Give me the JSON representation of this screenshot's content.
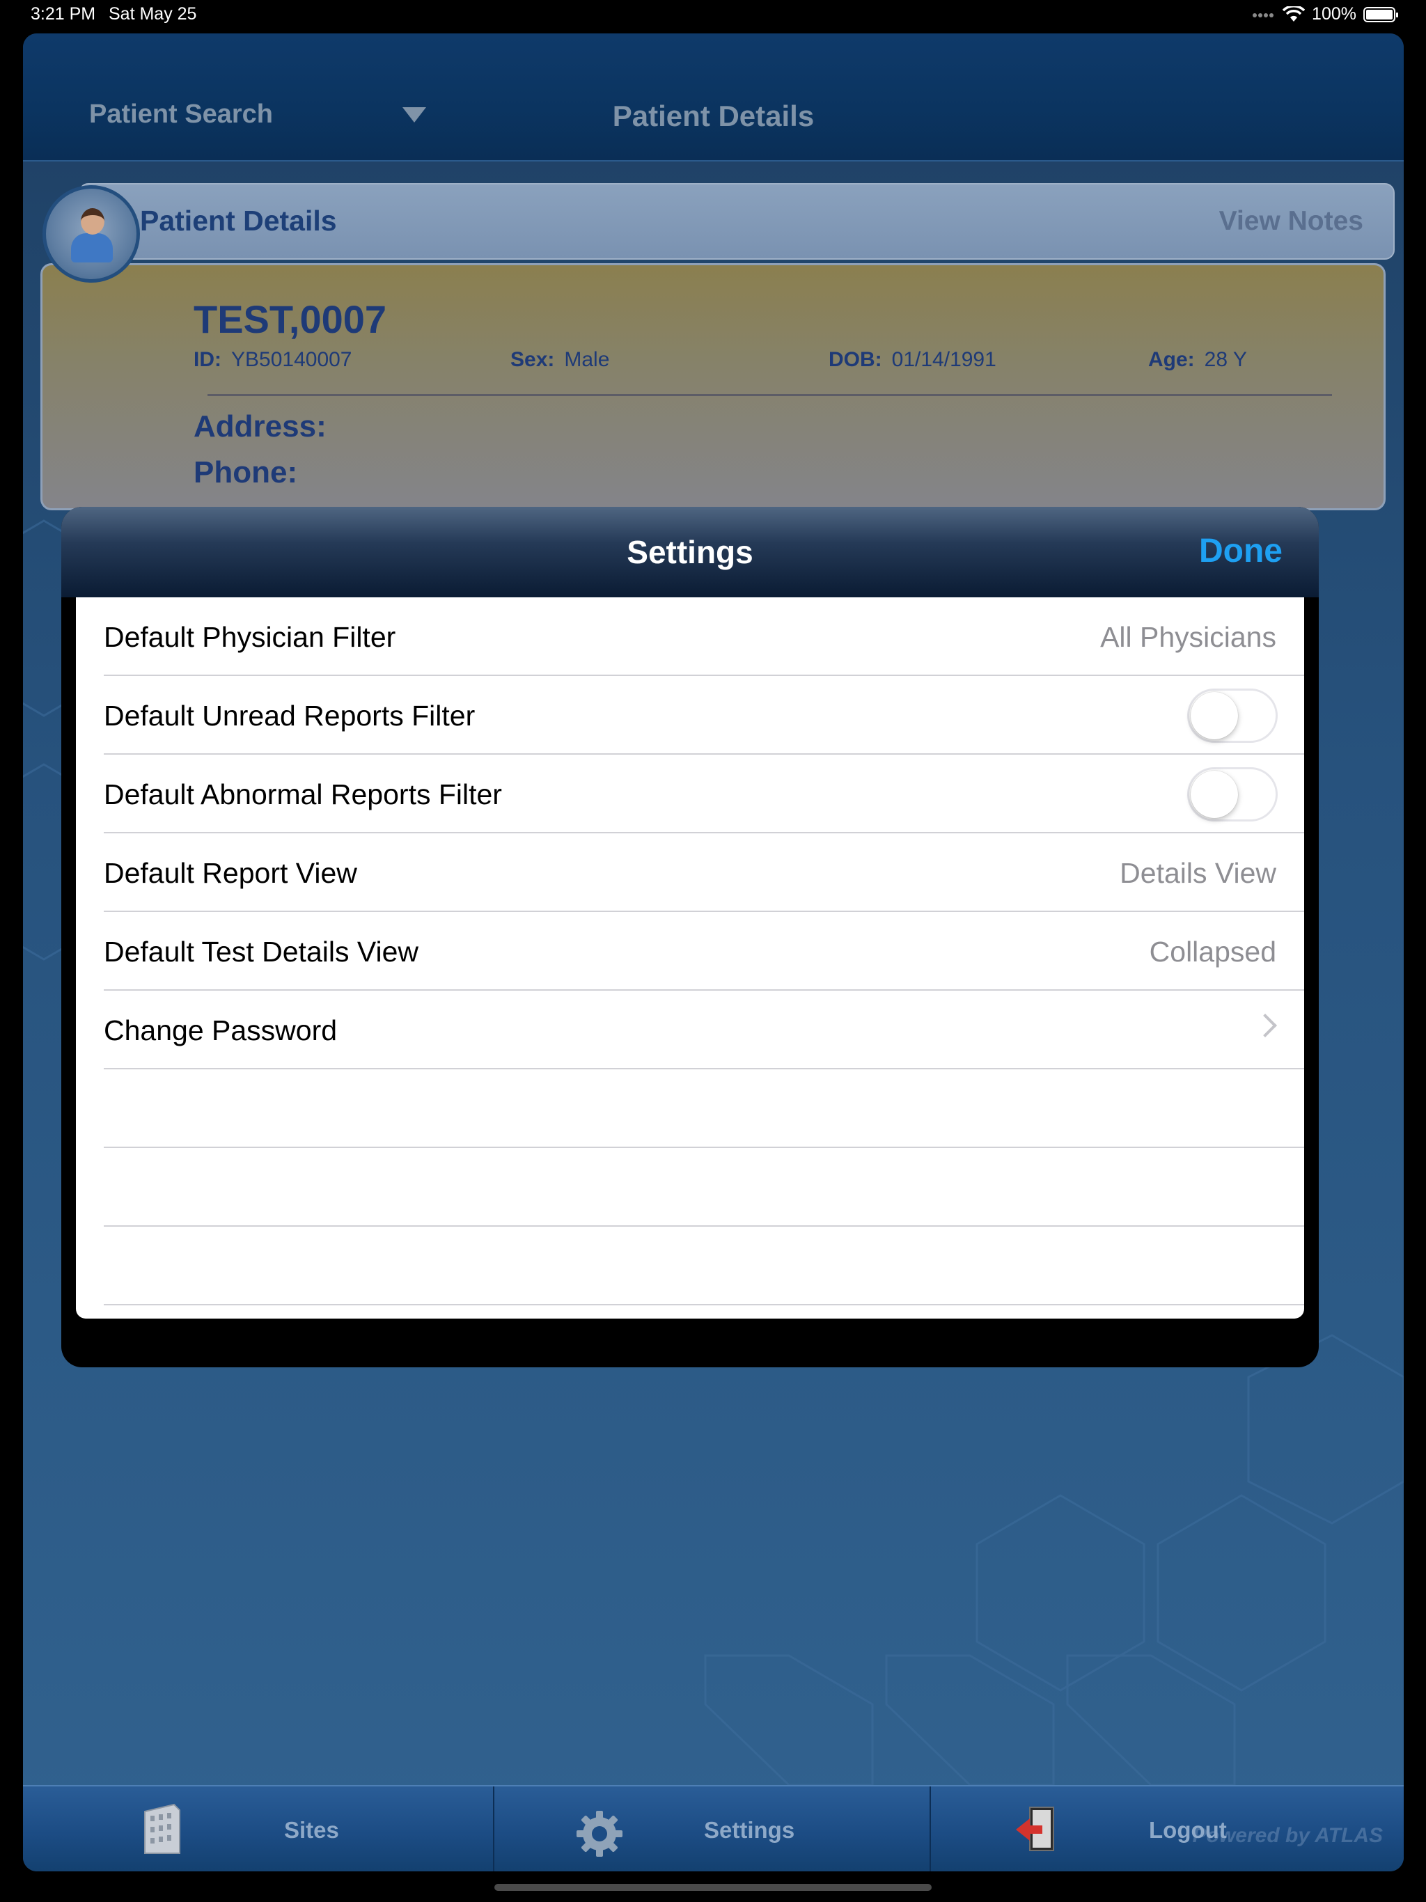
{
  "status_bar": {
    "time": "3:21 PM",
    "date": "Sat May 25",
    "battery": "100%"
  },
  "nav": {
    "left_label": "Patient Search",
    "title": "Patient Details"
  },
  "patient": {
    "header_title": "Patient Details",
    "view_notes": "View Notes",
    "name": "TEST,0007",
    "id_label": "ID:",
    "id_value": "YB50140007",
    "sex_label": "Sex:",
    "sex_value": "Male",
    "dob_label": "DOB:",
    "dob_value": "01/14/1991",
    "age_label": "Age:",
    "age_value": "28 Y",
    "address_label": "Address:",
    "phone_label": "Phone:"
  },
  "settings": {
    "title": "Settings",
    "done_label": "Done",
    "rows": [
      {
        "label": "Default Physician Filter",
        "value": "All Physicians",
        "control": "value"
      },
      {
        "label": "Default Unread Reports Filter",
        "value": "",
        "control": "toggle",
        "on": false
      },
      {
        "label": "Default Abnormal Reports Filter",
        "value": "",
        "control": "toggle",
        "on": false
      },
      {
        "label": "Default Report View",
        "value": "Details View",
        "control": "value"
      },
      {
        "label": "Default Test Details View",
        "value": "Collapsed",
        "control": "value"
      },
      {
        "label": "Change Password",
        "value": "",
        "control": "chevron"
      }
    ]
  },
  "tab_bar": {
    "sites": "Sites",
    "settings": "Settings",
    "logout": "Logout",
    "brand": "Powered by ATLAS"
  }
}
